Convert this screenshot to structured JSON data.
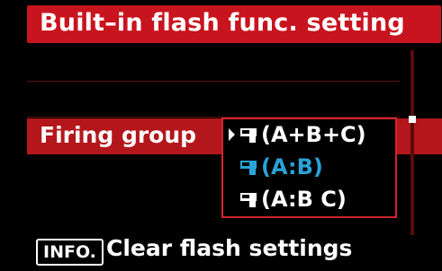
{
  "screen": {
    "title": "Built–in flash func. setting"
  },
  "menu": {
    "selected_label": "Firing group",
    "options": [
      {
        "label": "(A+B+C)",
        "icon": "flash-unit-icon",
        "current": true,
        "highlighted": false
      },
      {
        "label": "(A:B)",
        "icon": "flash-unit-icon",
        "current": false,
        "highlighted": true
      },
      {
        "label": "(A:B C)",
        "icon": "flash-unit-icon",
        "current": false,
        "highlighted": false
      }
    ]
  },
  "footer": {
    "info_label": "INFO.",
    "action_label": "Clear flash settings"
  },
  "colors": {
    "accent_red": "#c8141e",
    "highlight_blue": "#29a3d8"
  }
}
